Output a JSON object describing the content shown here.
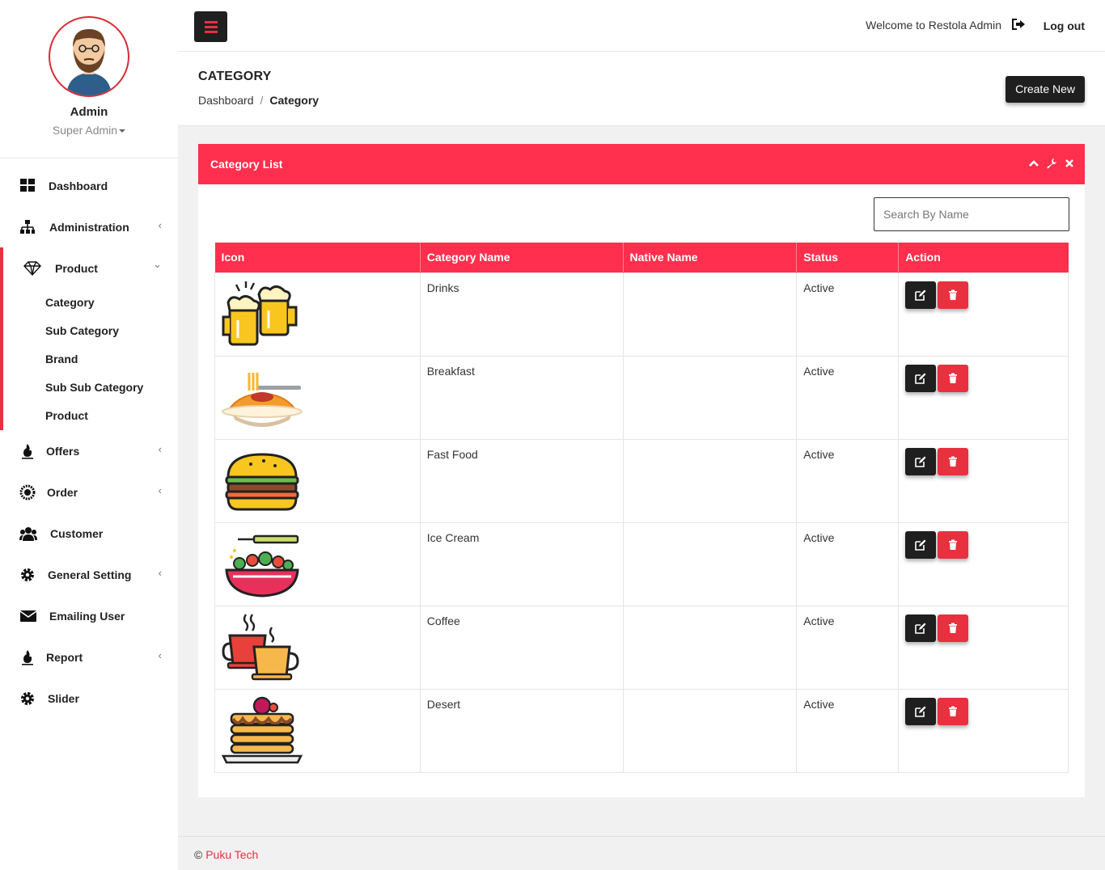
{
  "profile": {
    "name": "Admin",
    "role": "Super Admin"
  },
  "sidebar": {
    "items": [
      {
        "label": "Dashboard",
        "icon": "dashboard-icon",
        "chevron": false
      },
      {
        "label": "Administration",
        "icon": "sitemap-icon",
        "chevron": true
      },
      {
        "label": "Product",
        "icon": "diamond-icon",
        "chevron": true,
        "expanded": true
      },
      {
        "label": "Offers",
        "icon": "fire-icon",
        "chevron": true
      },
      {
        "label": "Order",
        "icon": "spinner-icon",
        "chevron": true
      },
      {
        "label": "Customer",
        "icon": "users-icon",
        "chevron": false
      },
      {
        "label": "General Setting",
        "icon": "gear-icon",
        "chevron": true
      },
      {
        "label": "Emailing User",
        "icon": "envelope-icon",
        "chevron": false
      },
      {
        "label": "Report",
        "icon": "fire-icon",
        "chevron": true
      },
      {
        "label": "Slider",
        "icon": "gear-icon",
        "chevron": false
      }
    ],
    "product_sub": [
      "Category",
      "Sub Category",
      "Brand",
      "Sub Sub Category",
      "Product"
    ],
    "chevron_left": "‹",
    "chevron_down": "⌄"
  },
  "topbar": {
    "welcome": "Welcome to Restola Admin",
    "logout": "Log out"
  },
  "page": {
    "title": "CATEGORY",
    "breadcrumb": {
      "home": "Dashboard",
      "separator": "/",
      "current": "Category"
    },
    "create_button": "Create New"
  },
  "card": {
    "title": "Category List",
    "search_placeholder": "Search By Name",
    "columns": [
      "Icon",
      "Category Name",
      "Native Name",
      "Status",
      "Action"
    ],
    "rows": [
      {
        "icon": "beer-mugs-icon",
        "name": "Drinks",
        "native": "",
        "status": "Active"
      },
      {
        "icon": "spaghetti-icon",
        "name": "Breakfast",
        "native": "",
        "status": "Active"
      },
      {
        "icon": "burger-icon",
        "name": "Fast Food",
        "native": "",
        "status": "Active"
      },
      {
        "icon": "salad-bowl-icon",
        "name": "Ice Cream",
        "native": "",
        "status": "Active"
      },
      {
        "icon": "coffee-cups-icon",
        "name": "Coffee",
        "native": "",
        "status": "Active"
      },
      {
        "icon": "pancakes-icon",
        "name": "Desert",
        "native": "",
        "status": "Active"
      }
    ]
  },
  "footer": {
    "copyright": "©",
    "company": "Puku Tech"
  },
  "colors": {
    "accent": "#ff2f4d",
    "danger": "#e8303f",
    "dark": "#1f1f1f"
  }
}
